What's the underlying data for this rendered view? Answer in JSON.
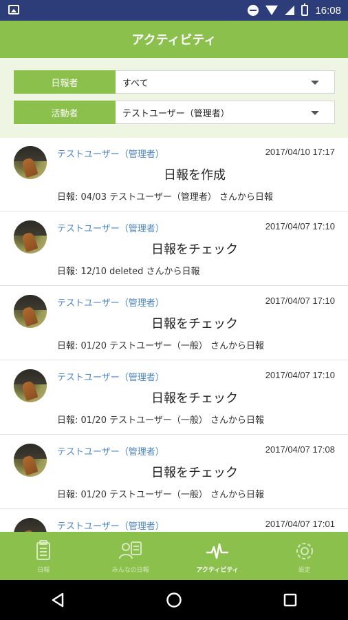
{
  "status_bar": {
    "time": "16:08"
  },
  "app_bar": {
    "title": "アクティビティ"
  },
  "filters": {
    "reporter": {
      "label": "日報者",
      "value": "すべて"
    },
    "actor": {
      "label": "活動者",
      "value": "テストユーザー（管理者）"
    }
  },
  "activities": [
    {
      "user": "テストユーザー（管理者）",
      "timestamp": "2017/04/10 17:17",
      "action": "日報を作成",
      "detail": "日報: 04/03 テストユーザー（管理者） さんから日報"
    },
    {
      "user": "テストユーザー（管理者）",
      "timestamp": "2017/04/07 17:10",
      "action": "日報をチェック",
      "detail": "日報: 12/10 deleted さんから日報"
    },
    {
      "user": "テストユーザー（管理者）",
      "timestamp": "2017/04/07 17:10",
      "action": "日報をチェック",
      "detail": "日報: 01/20 テストユーザー（一般） さんから日報"
    },
    {
      "user": "テストユーザー（管理者）",
      "timestamp": "2017/04/07 17:10",
      "action": "日報をチェック",
      "detail": "日報: 01/20 テストユーザー（一般） さんから日報"
    },
    {
      "user": "テストユーザー（管理者）",
      "timestamp": "2017/04/07 17:08",
      "action": "日報をチェック",
      "detail": "日報: 01/20 テストユーザー（一般） さんから日報"
    },
    {
      "user": "テストユーザー（管理者）",
      "timestamp": "2017/04/07 17:01",
      "action": "",
      "detail": ""
    }
  ],
  "tabs": [
    {
      "label": "日報",
      "icon": "clipboard-icon",
      "active": false
    },
    {
      "label": "みんなの日報",
      "icon": "people-report-icon",
      "active": false
    },
    {
      "label": "アクティビティ",
      "icon": "pulse-icon",
      "active": true
    },
    {
      "label": "設定",
      "icon": "gear-icon",
      "active": false
    }
  ],
  "colors": {
    "brand_green": "#8cc04c",
    "status_bar": "#2d3d7a",
    "link_blue": "#4a86c8",
    "filter_bg": "#eef5e3"
  }
}
